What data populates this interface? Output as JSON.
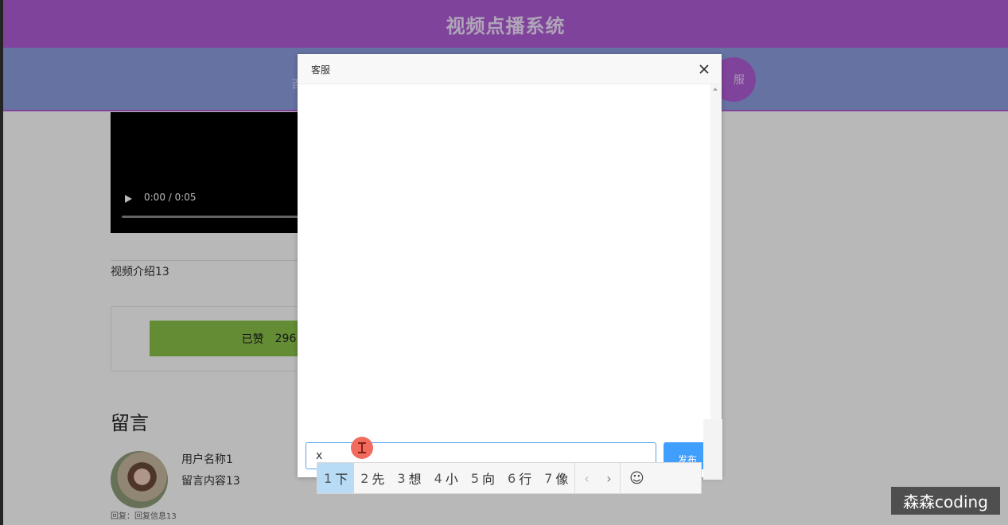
{
  "site": {
    "title": "视频点播系统"
  },
  "nav": {
    "left_label_fragment": "百",
    "right_label_fragment": "服"
  },
  "video": {
    "time_display": "0:00 / 0:05",
    "description": "视频介绍13"
  },
  "like": {
    "label": "已赞",
    "count": "296"
  },
  "comments": {
    "heading": "留言",
    "items": [
      {
        "username": "用户名称1",
        "content": "留言内容13",
        "reply": "回复：回复信息13"
      }
    ]
  },
  "dialog": {
    "title": "客服",
    "input_value": "x",
    "publish_label": "发布"
  },
  "ime": {
    "candidates": [
      {
        "num": "1",
        "text": "下"
      },
      {
        "num": "2",
        "text": "先"
      },
      {
        "num": "3",
        "text": "想"
      },
      {
        "num": "4",
        "text": "小"
      },
      {
        "num": "5",
        "text": "向"
      },
      {
        "num": "6",
        "text": "行"
      },
      {
        "num": "7",
        "text": "像"
      }
    ],
    "prev_label": "‹",
    "next_label": "›",
    "emoji_label": "☺",
    "selected_index": 0
  },
  "watermark": {
    "text": "森森coding"
  }
}
